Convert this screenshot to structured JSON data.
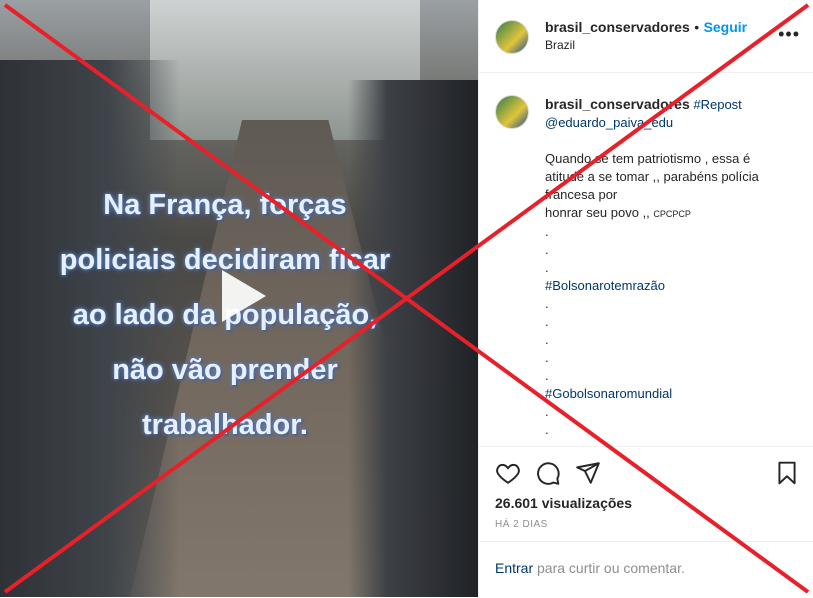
{
  "post": {
    "username": "brasil_conservadores",
    "separator": "•",
    "follow_label": "Seguir",
    "location": "Brazil",
    "more_label": "•••"
  },
  "video": {
    "overlay_lines": [
      "Na França, forças",
      "policiais decidiram ficar",
      "ao lado da população,",
      "não vão prender",
      "trabalhador."
    ]
  },
  "caption": {
    "username": "brasil_conservadores",
    "repost_tag": "#Repost",
    "mention": "@eduardo_paiva_edu",
    "line1": "Quando se tem patriotismo , essa é",
    "line2": "atitude a se tomar ,, parabéns polícia",
    "line3": "francesa por",
    "line4": "honrar seu povo ,, ",
    "line4_suffix": "CPCPCP",
    "dot": ".",
    "hashtag1": "#Bolsonarotemrazão",
    "hashtag2": "#Gobolsonaromundial"
  },
  "actions": {
    "views": "26.601 visualizações",
    "time": "HÁ 2 DIAS"
  },
  "login": {
    "link": "Entrar",
    "rest": " para curtir ou comentar."
  },
  "colors": {
    "accent": "#0095f6",
    "hashtag": "#00376b",
    "cross": "#e8202a"
  }
}
